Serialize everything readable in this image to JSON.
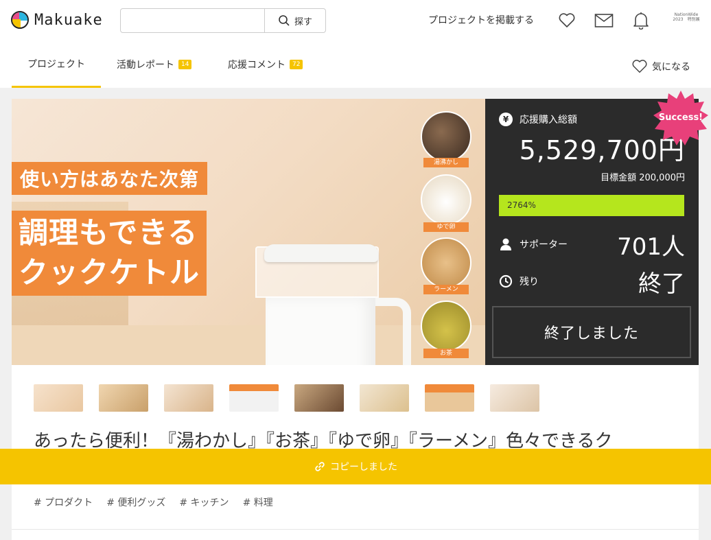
{
  "header": {
    "logo_text": "Makuake",
    "search_placeholder": "",
    "search_button": "探す",
    "post_project": "プロジェクトを掲載する",
    "avatar_text": "NationWide 2023　特別展"
  },
  "tabs": [
    {
      "label": "プロジェクト",
      "count": ""
    },
    {
      "label": "活動レポート",
      "count": "14"
    },
    {
      "label": "応援コメント",
      "count": "72"
    }
  ],
  "favorite_label": "気になる",
  "hero": {
    "tagline": "使い方はあなた次第",
    "title_line1": "調理もできる",
    "title_line2": "クックケトル",
    "thumbs": [
      "湯沸かし",
      "ゆで卵",
      "ラーメン",
      "お茶"
    ]
  },
  "panel": {
    "total_label": "応援購入総額",
    "currency_icon": "¥",
    "total_amount": "5,529,700円",
    "goal": "目標金額 200,000円",
    "progress_text": "2764%",
    "progress_fraction": 1.0,
    "supporters_label": "サポーター",
    "supporters_value": "701人",
    "remaining_label": "残り",
    "remaining_value": "終了",
    "ended_button": "終了しました",
    "success_badge": "Success!"
  },
  "project_title": "あったら便利！『湯わかし』『お茶』『ゆで卵』『ラーメン』色々できるク",
  "tags": [
    "# プロダクト",
    "# 便利グッズ",
    "# キッチン",
    "# 料理"
  ],
  "toast": "コピーしました",
  "colors": {
    "accent": "#f5c400",
    "orange": "#f08a3a",
    "progress": "#b5e61d",
    "success": "#e8407a"
  }
}
